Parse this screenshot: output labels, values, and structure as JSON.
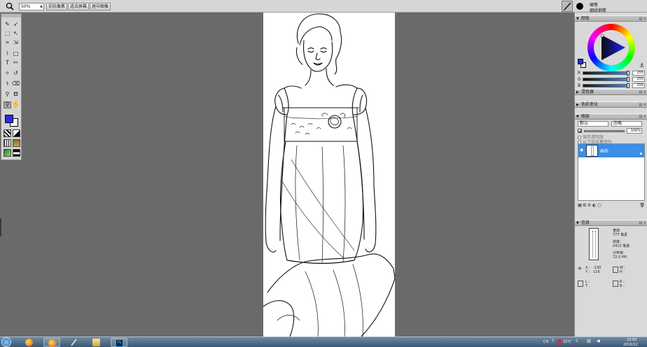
{
  "optionbar": {
    "zoom_value": "50%",
    "buttons": [
      "实际像素",
      "适合屏幕",
      "居中图像"
    ]
  },
  "brush_header": {
    "line1": "硬笔",
    "line2": "细线钢笔"
  },
  "panels": {
    "color": {
      "title": "颜色",
      "rgb": [
        {
          "label": "R",
          "value": "255"
        },
        {
          "label": "G",
          "value": "255"
        },
        {
          "label": "B",
          "value": "255"
        }
      ]
    },
    "mixer": {
      "title": "混色器"
    },
    "color_variation": {
      "title": "色彩变化"
    },
    "layers": {
      "title": "图层",
      "composite_method": "默认",
      "composite_depth": "忽略",
      "opacity": "100%",
      "options": [
        "保持透明度",
        "从下层采集颜色"
      ],
      "layer_name": "画布"
    },
    "info": {
      "title": "信息",
      "width_label": "宽度:",
      "width_value": "777 像素",
      "height_label": "高度:",
      "height_value": "2413 像素",
      "resolution_label": "分辨率:",
      "resolution_value": "72.0 PPI",
      "x_label": "X :",
      "x_value": "-130",
      "y_label": "Y :",
      "y_value": "116",
      "w_label": "W :",
      "h_label": "H :",
      "l_label": "L :",
      "r_label": "R :",
      "b_label": "B :",
      "t_label": "T :"
    }
  },
  "taskbar": {
    "lang": "CH",
    "temp": "22℃",
    "time": "23:50",
    "date": "2016/12"
  },
  "colors": {
    "accent": "#3a8fe6",
    "foreground_swatch": "#2d2de0",
    "background_swatch": "#ffffff",
    "workspace": "#6a6a6a"
  }
}
